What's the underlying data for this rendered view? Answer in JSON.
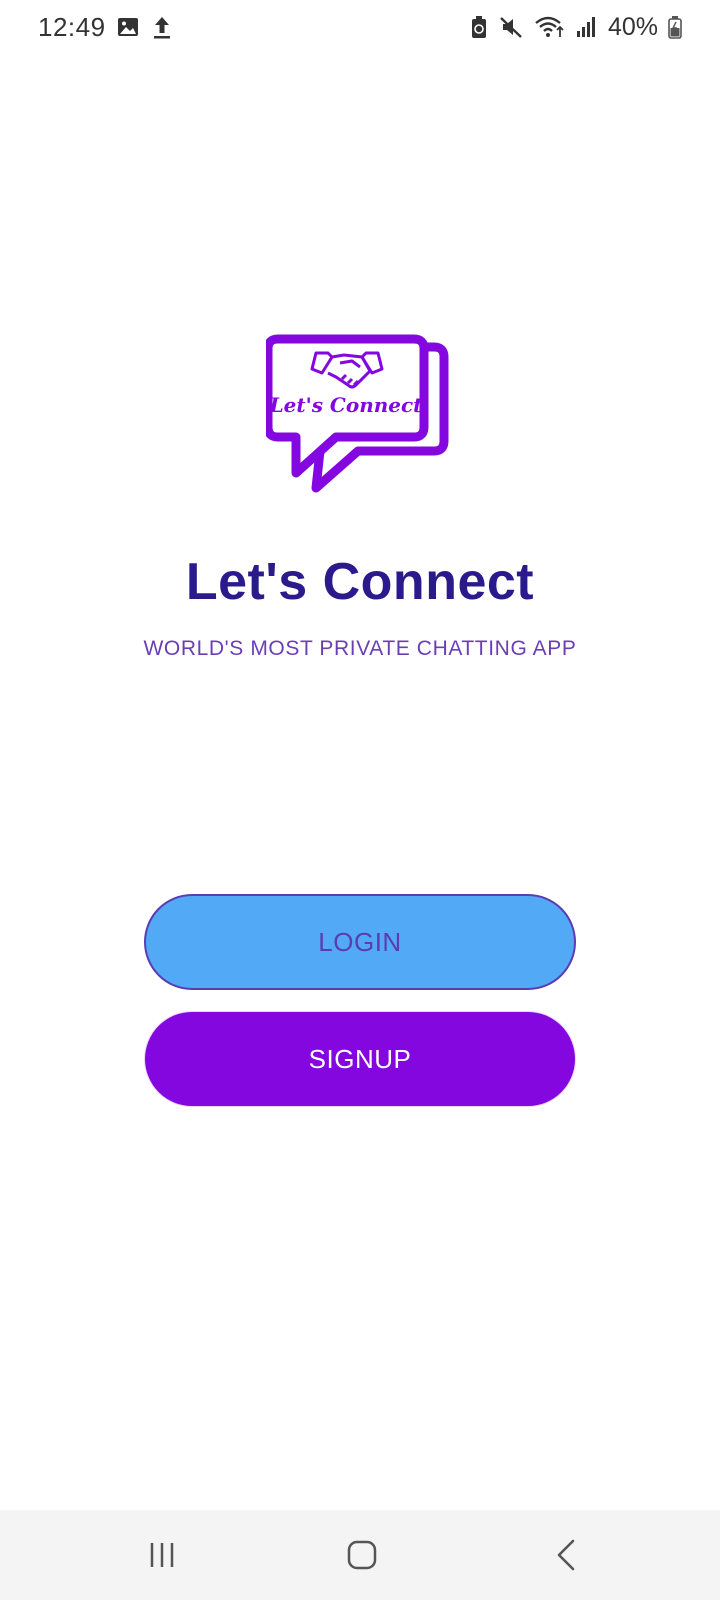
{
  "status_bar": {
    "time": "12:49",
    "left_icons": [
      "image-icon",
      "upload-icon"
    ],
    "right_icons": [
      "battery-saver-icon",
      "mute-icon",
      "wifi-icon",
      "signal-icon"
    ],
    "battery_percent": "40%"
  },
  "logo": {
    "text": "Let's Connect",
    "icon": "handshake-icon",
    "color": "#8407e0"
  },
  "app": {
    "title": "Let's Connect",
    "tagline": "WORLD'S MOST PRIVATE CHATTING APP"
  },
  "actions": {
    "login_label": "LOGIN",
    "signup_label": "SIGNUP"
  },
  "colors": {
    "title": "#2a1a8c",
    "tagline": "#6a3fb5",
    "login_bg": "#52a9f5",
    "login_text": "#5a3db3",
    "signup_bg": "#8407e0",
    "signup_text": "#ffffff"
  },
  "nav_bar": {
    "buttons": [
      "recents-icon",
      "home-icon",
      "back-icon"
    ]
  }
}
